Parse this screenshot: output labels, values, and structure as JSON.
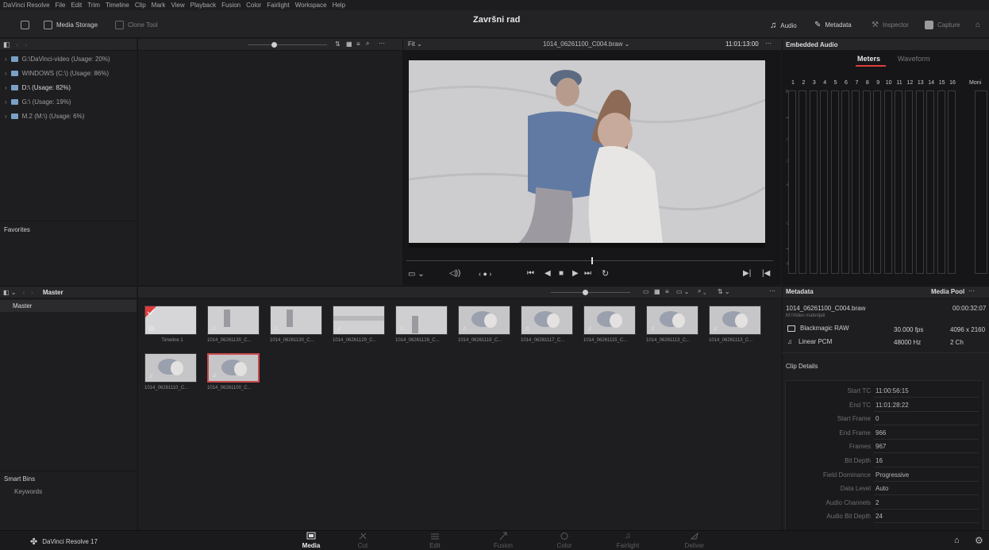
{
  "menu": [
    "DaVinci Resolve",
    "File",
    "Edit",
    "Trim",
    "Timeline",
    "Clip",
    "Mark",
    "View",
    "Playback",
    "Fusion",
    "Color",
    "Fairlight",
    "Workspace",
    "Help"
  ],
  "toolbar": {
    "media_storage": "Media Storage",
    "clone_tool": "Clone Tool",
    "project_title": "Završni rad",
    "audio": "Audio",
    "metadata": "Metadata",
    "inspector": "Inspector",
    "capture": "Capture"
  },
  "storage": {
    "drives": [
      "G:\\DaVinci-video (Usage: 20%)",
      "WINDOWS (C:\\) (Usage: 86%)",
      "D:\\ (Usage: 82%)",
      "G:\\ (Usage: 19%)",
      "M.2  (M:\\) (Usage: 6%)"
    ],
    "favorites": "Favorites"
  },
  "viewer": {
    "zoom": "Fit",
    "clip_name": "1014_06261100_C004.braw",
    "timecode": "11:01:13:00"
  },
  "audio_panel": {
    "title": "Embedded Audio",
    "tab_meters": "Meters",
    "tab_waveform": "Waveform",
    "channels": [
      "1",
      "2",
      "3",
      "4",
      "5",
      "6",
      "7",
      "8",
      "9",
      "10",
      "11",
      "12",
      "13",
      "14",
      "15",
      "16"
    ],
    "monitor": "Moni",
    "scale": [
      "0-",
      "-4-",
      "-10-",
      "-16-",
      "-20-",
      "-30-",
      "-40-",
      "-50-"
    ]
  },
  "media_pool": {
    "bin": "Master",
    "bin_list": [
      "Master"
    ],
    "smart_bins": "Smart Bins",
    "keywords": "Keywords",
    "clips": [
      {
        "label": "Timeline 1"
      },
      {
        "label": "1014_06261130_C..."
      },
      {
        "label": "1014_06261130_C..."
      },
      {
        "label": "1014_06261129_C..."
      },
      {
        "label": "1014_06261128_C..."
      },
      {
        "label": "1014_06261119_C..."
      },
      {
        "label": "1014_06261117_C..."
      },
      {
        "label": "1014_06261115_C..."
      },
      {
        "label": "1014_06261113_C..."
      },
      {
        "label": "1014_06261113_C..."
      },
      {
        "label": "1014_06261110_C..."
      },
      {
        "label": "1014_06261100_C..."
      }
    ]
  },
  "metadata": {
    "title": "Metadata",
    "media_pool_label": "Media Pool",
    "clip_name": "1014_06261100_C004.braw",
    "duration": "00:00:32:07",
    "path": "M:\\Video materijali",
    "codec": "Blackmagic RAW",
    "fps": "30.000 fps",
    "resolution": "4096 x 2160",
    "audio_codec": "Linear PCM",
    "sample_rate": "48000 Hz",
    "audio_ch": "2 Ch",
    "clip_details": "Clip Details",
    "details": [
      {
        "label": "Start TC",
        "value": "11:00:56:15"
      },
      {
        "label": "End TC",
        "value": "11:01:28:22"
      },
      {
        "label": "Start Frame",
        "value": "0"
      },
      {
        "label": "End Frame",
        "value": "966"
      },
      {
        "label": "Frames",
        "value": "967"
      },
      {
        "label": "Bit Depth",
        "value": "16"
      },
      {
        "label": "Field Dominance",
        "value": "Progressive"
      },
      {
        "label": "Data Level",
        "value": "Auto"
      },
      {
        "label": "Audio Channels",
        "value": "2"
      },
      {
        "label": "Audio Bit Depth",
        "value": "24"
      }
    ]
  },
  "bottom": {
    "app_name": "DaVinci Resolve 17",
    "pages": [
      "Media",
      "Cut",
      "Edit",
      "Fusion",
      "Color",
      "Fairlight",
      "Deliver"
    ]
  },
  "colors": {
    "accent_red": "#e03c3c",
    "drive_blue": "#7aa0c8"
  }
}
